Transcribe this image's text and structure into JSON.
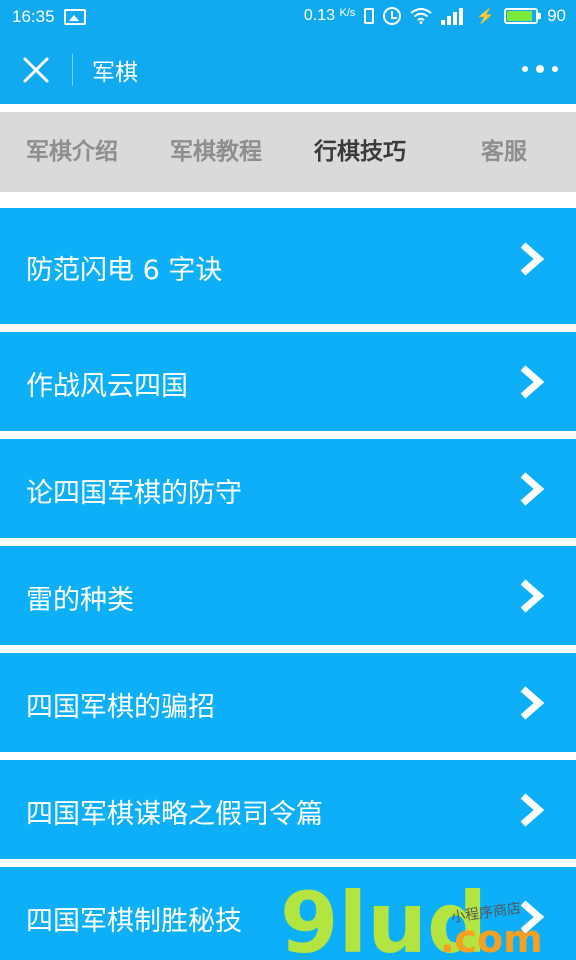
{
  "status_bar": {
    "time": "16:35",
    "speed": "0.13",
    "speed_unit": "K/s",
    "network": "4G",
    "battery": "90",
    "battery_color": "#7bea3a"
  },
  "navbar": {
    "title": "军棋",
    "close_icon": "close-icon",
    "more_icon": "more-icon",
    "color": "#11aaf0"
  },
  "tabs": [
    {
      "label": "军棋介绍",
      "active": false
    },
    {
      "label": "军棋教程",
      "active": false
    },
    {
      "label": "行棋技巧",
      "active": true
    },
    {
      "label": "客服",
      "active": false
    }
  ],
  "items": [
    {
      "label": "防范闪电 6 字诀"
    },
    {
      "label": "作战风云四国"
    },
    {
      "label": "论四国军棋的防守"
    },
    {
      "label": "雷的种类"
    },
    {
      "label": "四国军棋的骗招"
    },
    {
      "label": "四国军棋谋略之假司令篇"
    },
    {
      "label": "四国军棋制胜秘技"
    }
  ],
  "watermark": {
    "brand": "9lud",
    "domain": ".com",
    "tagline": "小程序商店"
  },
  "colors": {
    "item_bg": "#0db0f8",
    "tab_bg": "#dadada",
    "watermark_green": "#c6ea2a",
    "watermark_orange": "#f5a020"
  }
}
